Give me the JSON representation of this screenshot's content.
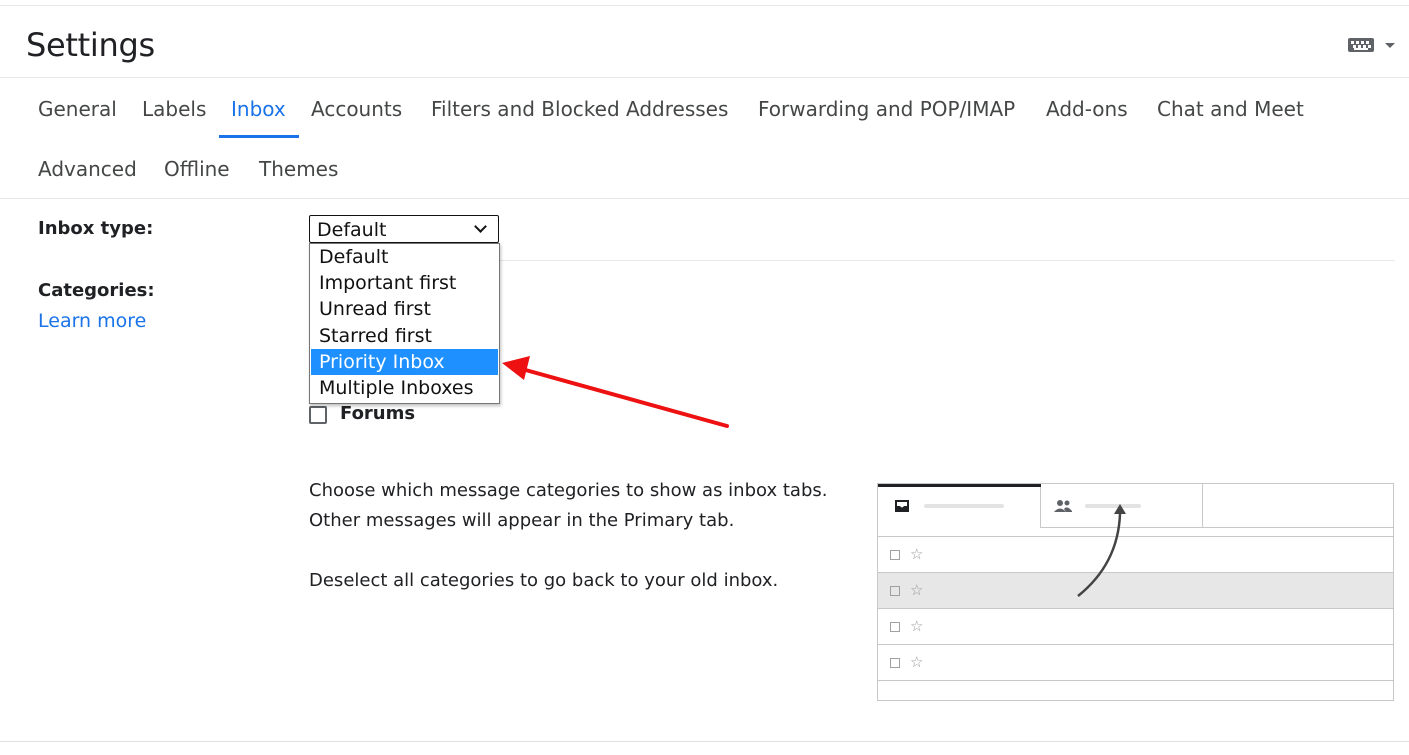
{
  "page": {
    "title": "Settings"
  },
  "header": {
    "keyboard_icon": "keyboard-icon",
    "caret_icon": "caret-down-icon"
  },
  "tabs": [
    {
      "label": "General",
      "active": false
    },
    {
      "label": "Labels",
      "active": false
    },
    {
      "label": "Inbox",
      "active": true
    },
    {
      "label": "Accounts",
      "active": false
    },
    {
      "label": "Filters and Blocked Addresses",
      "active": false
    },
    {
      "label": "Forwarding and POP/IMAP",
      "active": false
    },
    {
      "label": "Add-ons",
      "active": false
    },
    {
      "label": "Chat and Meet",
      "active": false
    },
    {
      "label": "Advanced",
      "active": false
    },
    {
      "label": "Offline",
      "active": false
    },
    {
      "label": "Themes",
      "active": false
    }
  ],
  "inbox_type": {
    "label": "Inbox type:",
    "selected_value": "Default",
    "options": [
      "Default",
      "Important first",
      "Unread first",
      "Starred first",
      "Priority Inbox",
      "Multiple Inboxes"
    ],
    "highlighted_option": "Priority Inbox"
  },
  "categories": {
    "label": "Categories:",
    "learn_more": "Learn more",
    "visible_checkbox_label": "Forums",
    "description_1": "Choose which message categories to show as inbox tabs. Other messages will appear in the Primary tab.",
    "description_2": "Deselect all categories to go back to your old inbox."
  },
  "illustration": {
    "tab1_icon": "inbox-icon",
    "tab2_icon": "people-icon",
    "row_icon": "star-icon",
    "star_glyph": "☆"
  },
  "colors": {
    "accent": "#1a73e8",
    "highlight": "#1e90ff",
    "annotation_arrow": "#ee1111"
  }
}
